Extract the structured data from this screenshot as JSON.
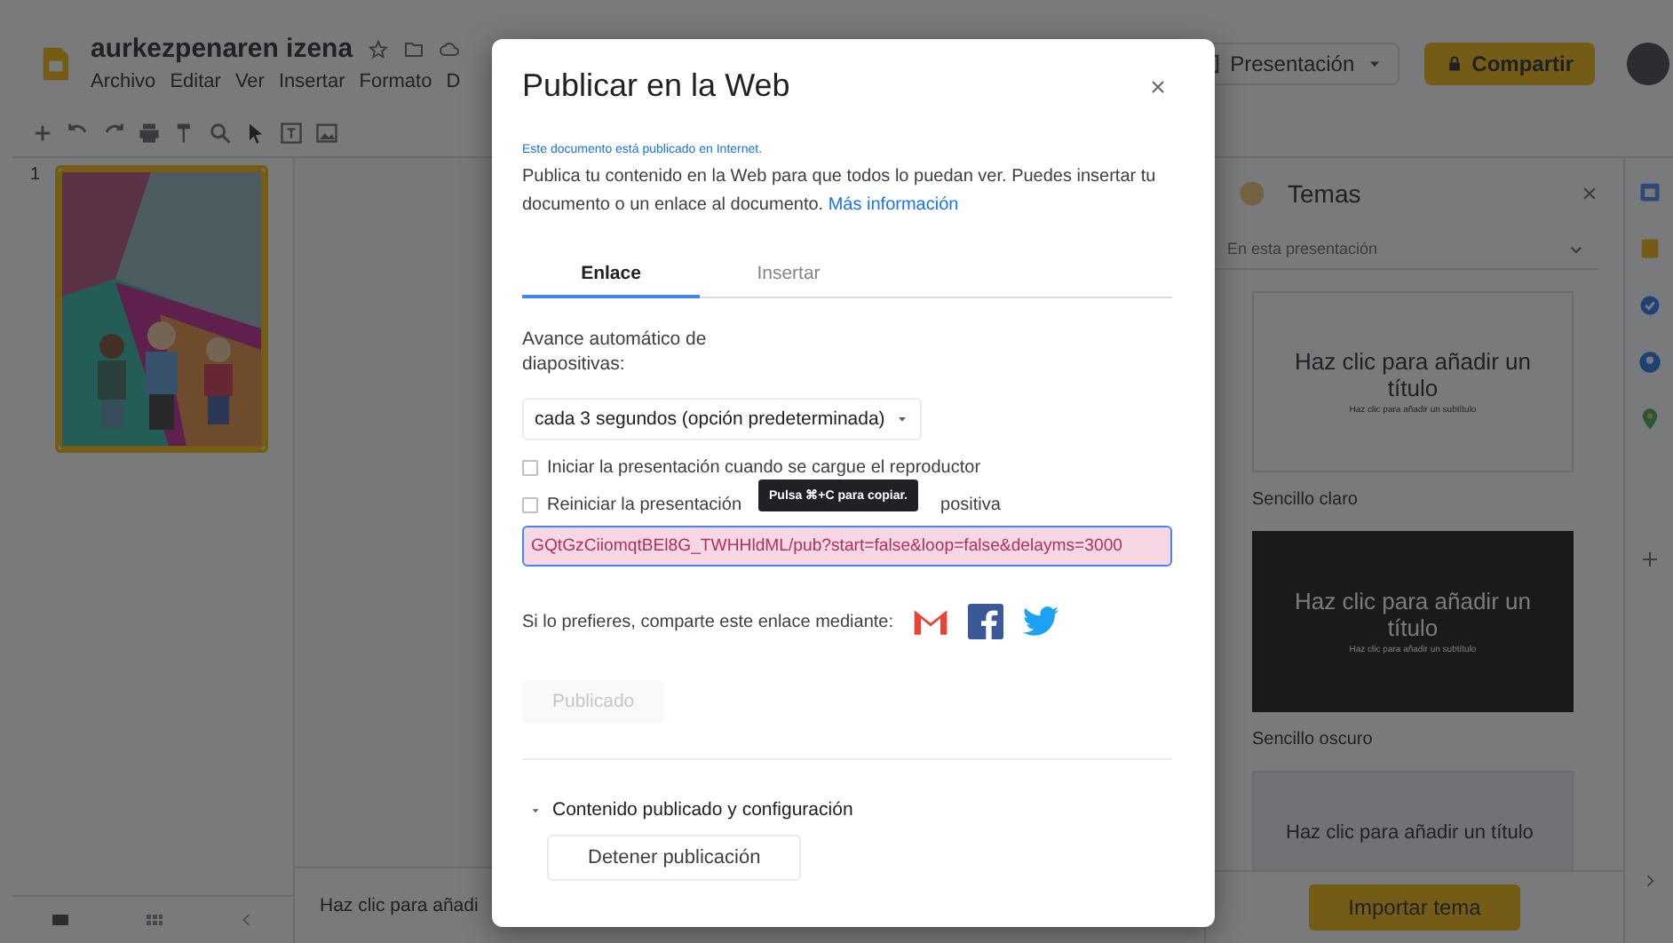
{
  "document": {
    "title": "aurkezpenaren izena",
    "menu": [
      "Archivo",
      "Editar",
      "Ver",
      "Insertar",
      "Formato",
      "D"
    ]
  },
  "header_buttons": {
    "present": "Presentación",
    "share": "Compartir"
  },
  "filmstrip": {
    "slides": [
      {
        "number": "1",
        "kind": "picture",
        "selected": true
      }
    ]
  },
  "notes": {
    "placeholder": "Haz clic para añadi"
  },
  "themes": {
    "title": "Temas",
    "filter": "En esta presentación",
    "items": [
      {
        "kind": "light",
        "title": "Haz clic para añadir un título",
        "subtitle": "Haz clic para añadir un subtítulo",
        "name": "Sencillo claro"
      },
      {
        "kind": "dark",
        "title": "Haz clic para añadir un título",
        "subtitle": "Haz clic para añadir un subtítulo",
        "name": "Sencillo oscuro"
      },
      {
        "kind": "grey",
        "title": "Haz clic para añadir un título"
      }
    ],
    "import_button": "Importar tema"
  },
  "dialog": {
    "title": "Publicar en la Web",
    "status": "Este documento está publicado en Internet.",
    "description": "Publica tu contenido en la Web para que todos lo puedan ver. Puedes insertar tu documento o un enlace al documento.",
    "more_link": "Más información",
    "tabs": [
      {
        "label": "Enlace",
        "selected": true
      },
      {
        "label": "Insertar",
        "selected": false
      }
    ],
    "auto_advance": {
      "label": "Avance automático de diapositivas:",
      "value": "cada 3 segundos (opción predeterminada)"
    },
    "options": [
      {
        "label": "Iniciar la presentación cuando se cargue el reproductor",
        "checked": false
      },
      {
        "label": "Reiniciar la presentación",
        "label_end": "positiva",
        "checked": false
      }
    ],
    "tooltip": "Pulsa ⌘+C para copiar.",
    "link_field": {
      "value": "GQtGzCiiomqtBEl8G_TWHHldML/pub?start=false&loop=false&delayms=3000",
      "highlighted": true
    },
    "share": {
      "label": "Si lo prefieres, comparte este enlace mediante:"
    },
    "publish_button": {
      "label": "Publicado",
      "disabled": true
    },
    "section": {
      "label": "Contenido publicado y configuración",
      "expanded": true
    },
    "stop_button": "Detener publicación"
  }
}
